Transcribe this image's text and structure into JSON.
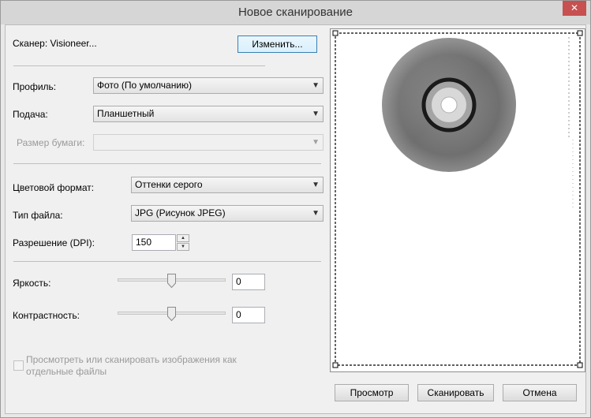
{
  "window": {
    "title": "Новое сканирование",
    "close_glyph": "✕"
  },
  "scanner": {
    "label": "Сканер: Visioneer...",
    "change_button": "Изменить..."
  },
  "profile": {
    "label": "Профиль:",
    "value": "Фото (По умолчанию)"
  },
  "source": {
    "label": "Подача:",
    "value": "Планшетный"
  },
  "paper_size": {
    "label": "Размер бумаги:",
    "value": ""
  },
  "color_format": {
    "label": "Цветовой формат:",
    "value": "Оттенки серого"
  },
  "file_type": {
    "label": "Тип файла:",
    "value": "JPG (Рисунок JPEG)"
  },
  "resolution": {
    "label": "Разрешение (DPI):",
    "value": "150"
  },
  "brightness": {
    "label": "Яркость:",
    "value": "0",
    "slider_level": 0.5
  },
  "contrast": {
    "label": "Контрастность:",
    "value": "0",
    "slider_level": 0.5
  },
  "separate_files": {
    "line1": "Просмотреть или сканировать изображения как",
    "line2": "отдельные файлы",
    "checked": false
  },
  "buttons": {
    "preview": "Просмотр",
    "scan": "Сканировать",
    "cancel": "Отмена"
  },
  "icons": {
    "dropdown": "chevron-down-icon",
    "spin_up": "up-arrow-icon",
    "spin_down": "down-arrow-icon"
  },
  "colors": {
    "close_button": "#c75050",
    "default_button_border": "#3c7fb1"
  }
}
